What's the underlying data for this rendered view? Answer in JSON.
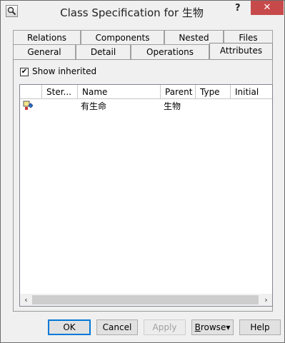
{
  "window": {
    "title": "Class Specification for 生物",
    "help_glyph": "?",
    "close_glyph": "✕"
  },
  "tabs": {
    "row_back": [
      "Relations",
      "Components",
      "Nested",
      "Files"
    ],
    "row_front": [
      "General",
      "Detail",
      "Operations",
      "Attributes"
    ],
    "active": "Attributes"
  },
  "options": {
    "show_inherited_label": "Show inherited",
    "show_inherited_checked": "✔"
  },
  "grid": {
    "columns": [
      "",
      "Ster...",
      "Name",
      "Parent",
      "Type",
      "Initial"
    ],
    "rows": [
      {
        "icon": "attribute-icon",
        "stereotype": "",
        "name": "有生命",
        "parent": "生物",
        "type": "",
        "initial": ""
      }
    ]
  },
  "scrollbar": {
    "left_arrow": "‹",
    "right_arrow": "›"
  },
  "buttons": {
    "ok": "OK",
    "cancel": "Cancel",
    "apply": "Apply",
    "browse_prefix": "B",
    "browse_rest": "rowse",
    "browse_arrow": "▾",
    "help": "Help"
  }
}
